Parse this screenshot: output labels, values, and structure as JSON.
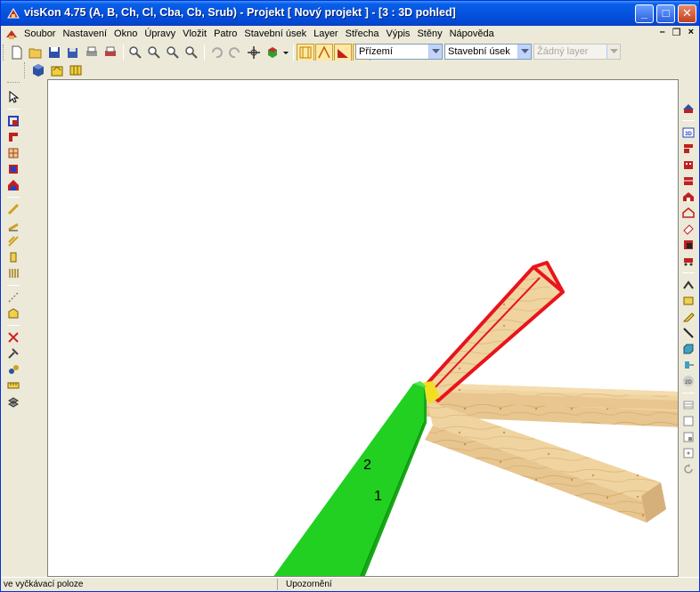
{
  "window": {
    "title": "visKon 4.75 (A, B, Ch, Cl, Cba, Cb, Srub) - Projekt [ Nový projekt ]  - [3 : 3D pohled]",
    "minimize": "_",
    "maximize": "□",
    "close": "✕"
  },
  "menu": {
    "items": [
      "Soubor",
      "Nastavení",
      "Okno",
      "Úpravy",
      "Vložit",
      "Patro",
      "Stavební úsek",
      "Layer",
      "Střecha",
      "Výpis",
      "Stěny",
      "Nápověda"
    ],
    "mdi_minimize": "–",
    "mdi_restore": "❐",
    "mdi_close": "×"
  },
  "toolbar": {
    "floor_select": "Přízemí",
    "section_select": "Stavební úsek",
    "layer_select": "Žádný layer"
  },
  "viewport": {
    "label_1": "1",
    "label_2": "2"
  },
  "status": {
    "left": "ve vyčkávací poloze",
    "center": "Upozornění"
  },
  "colors": {
    "title_bar": "#0453df",
    "chrome": "#ece9d8",
    "beam_green": "#20c820",
    "beam_highlight": "#e8141c",
    "wood": "#e8c690"
  }
}
